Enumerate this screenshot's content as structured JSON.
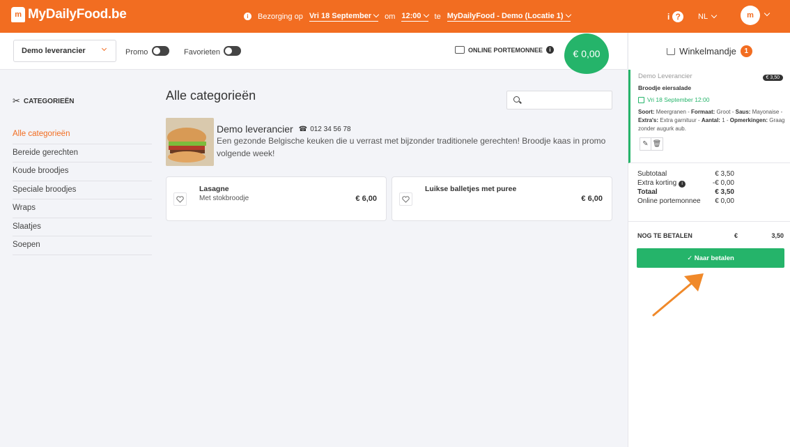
{
  "brand": {
    "name": "MyDailyFood.be",
    "mark": "m"
  },
  "delivery": {
    "label": "Bezorging op",
    "date": "Vri 18 September",
    "om": "om",
    "time": "12:00",
    "te": "te",
    "location": "MyDailyFood - Demo (Locatie 1)"
  },
  "topright": {
    "info": "i",
    "help": "?",
    "language": "NL",
    "avatar": "m"
  },
  "filters": {
    "supplier": "Demo leverancier",
    "promo_label": "Promo",
    "favorites_label": "Favorieten",
    "wallet_label": "ONLINE PORTEMONNEE",
    "wallet_info": "i",
    "balance": "€ 0,00"
  },
  "sidebar": {
    "title": "CATEGORIEËN",
    "items": [
      {
        "label": "Alle categorieën",
        "active": true
      },
      {
        "label": "Bereide gerechten"
      },
      {
        "label": "Koude broodjes"
      },
      {
        "label": "Speciale broodjes"
      },
      {
        "label": "Wraps"
      },
      {
        "label": "Slaatjes"
      },
      {
        "label": "Soepen"
      }
    ]
  },
  "main": {
    "title": "Alle categorieën",
    "supplier": {
      "name": "Demo leverancier",
      "phone": "012 34 56 78",
      "description": "Een gezonde Belgische keuken die u verrast met bijzonder traditionele gerechten! Broodje kaas in promo volgende week!"
    },
    "products": [
      {
        "name": "Lasagne",
        "desc": "Met stokbroodje",
        "price": "€ 6,00",
        "favorite": false
      },
      {
        "name": "Luikse balletjes met puree",
        "desc": "",
        "price": "€ 6,00",
        "favorite": false
      }
    ]
  },
  "cart": {
    "title": "Winkelmandje",
    "count": "1",
    "item": {
      "supplier": "Demo Leverancier",
      "price": "€ 3,50",
      "name": "Broodje eiersalade",
      "date": "Vri 18 September 12:00",
      "soort_label": "Soort:",
      "soort": "Meergranen",
      "formaat_label": "Formaat:",
      "formaat": "Groot",
      "saus_label": "Saus:",
      "saus": "Mayonaise",
      "extras_label": "Extra's:",
      "extras": "Extra garnituur",
      "aantal_label": "Aantal:",
      "aantal": "1",
      "opm_label": "Opmerkingen:",
      "opm": "Graag zonder augurk aub."
    },
    "totals": {
      "subtotal_label": "Subtotaal",
      "subtotal": "€ 3,50",
      "discount_label": "Extra korting",
      "discount": "-€ 0,00",
      "total_label": "Totaal",
      "total": "€ 3,50",
      "wallet_label": "Online portemonnee",
      "wallet": "€ 0,00"
    },
    "due_label": "NOG TE BETALEN",
    "due_currency": "€",
    "due_amount": "3,50",
    "pay_button": "✓ Naar betalen"
  },
  "colors": {
    "brand": "#f26d21",
    "success": "#25b46a"
  }
}
